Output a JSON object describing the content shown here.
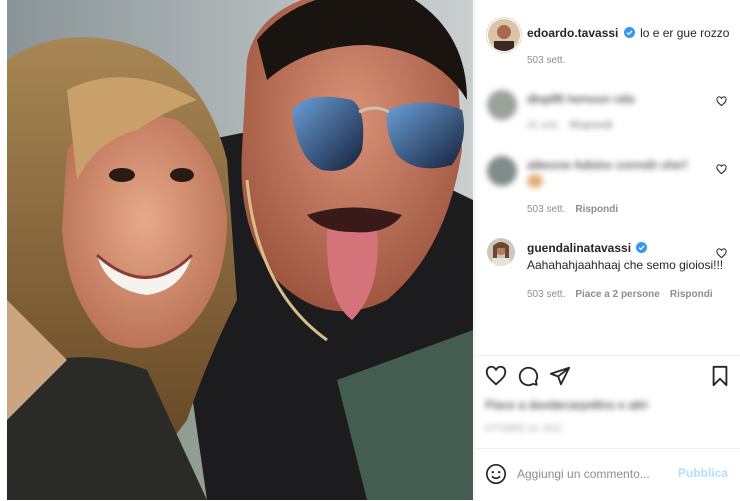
{
  "post": {
    "author": "edoardo.tavassi",
    "caption": "lo e er gue rozzo",
    "caption_time": "503 sett."
  },
  "comments": [
    {
      "user": "dbqdf8 hemoon rafa",
      "text": "",
      "time": "41 sett.",
      "reply_label": "Rispondi",
      "blurred": true
    },
    {
      "user": "alikezoe",
      "text": "Adislov connsth ohe!!",
      "time": "503 sett.",
      "reply_label": "Rispondi",
      "blurred_partial": true
    },
    {
      "user": "guendalinatavassi",
      "text": "Aahahahjaahhaaj che semo gioiosi!!!",
      "time": "503 sett.",
      "likes_label": "Piace a 2 persone",
      "reply_label": "Rispondi"
    }
  ],
  "likes": {
    "text": "Piace a davidecarpellino e altri"
  },
  "date": "OTTOBRE 10, 2012",
  "comment_box": {
    "placeholder": "Aggiungi un commento...",
    "post_label": "Pubblica"
  },
  "icons": {
    "like": "heart-icon",
    "comment": "comment-icon",
    "share": "send-icon",
    "save": "bookmark-icon",
    "emoji": "emoji-icon",
    "verified": "verified-badge-icon"
  },
  "colors": {
    "verified": "#3897f0",
    "post_button_disabled": "#b2dffc",
    "meta_text": "#8e8e8e"
  }
}
